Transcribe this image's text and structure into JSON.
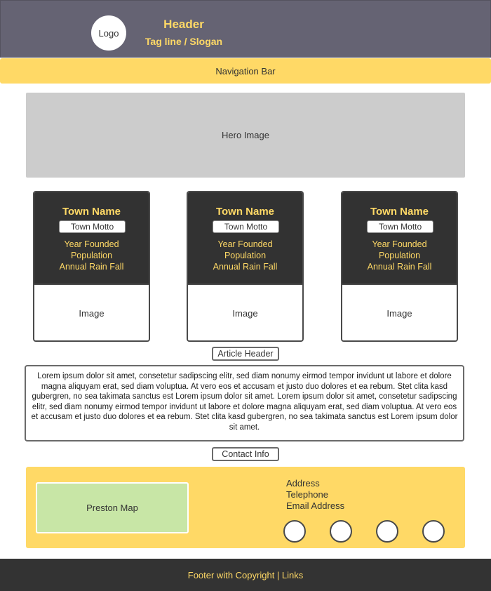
{
  "header": {
    "logo_label": "Logo",
    "title": "Header",
    "tagline": "Tag line / Slogan"
  },
  "navigation": {
    "label": "Navigation Bar"
  },
  "hero": {
    "label": "Hero Image"
  },
  "towns": [
    {
      "name": "Town Name",
      "motto": "Town Motto",
      "year": "Year Founded",
      "population": "Population",
      "rainfall": "Annual Rain Fall",
      "image_label": "Image"
    },
    {
      "name": "Town Name",
      "motto": "Town Motto",
      "year": "Year Founded",
      "population": "Population",
      "rainfall": "Annual Rain Fall",
      "image_label": "Image"
    },
    {
      "name": "Town Name",
      "motto": "Town Motto",
      "year": "Year Founded",
      "population": "Population",
      "rainfall": "Annual Rain Fall",
      "image_label": "Image"
    }
  ],
  "article": {
    "header": "Article Header",
    "body": "Lorem ipsum dolor sit amet, consetetur sadipscing elitr, sed diam nonumy eirmod tempor invidunt ut labore et dolore magna aliquyam erat, sed diam voluptua. At vero eos et accusam et justo duo dolores et ea rebum. Stet clita kasd gubergren, no sea takimata sanctus est Lorem ipsum dolor sit amet. Lorem ipsum dolor sit amet, consetetur sadipscing elitr, sed diam nonumy eirmod tempor invidunt ut labore et dolore magna aliquyam erat, sed diam voluptua. At vero eos et accusam et justo duo dolores et ea rebum. Stet clita kasd gubergren, no sea takimata sanctus est Lorem ipsum dolor sit amet."
  },
  "contact": {
    "header": "Contact Info",
    "map_label": "Preston Map",
    "address": "Address",
    "telephone": "Telephone",
    "email": "Email Address",
    "social_icons": [
      "social-circle-icon",
      "social-circle-icon",
      "social-circle-icon",
      "social-circle-icon"
    ]
  },
  "footer": {
    "text": "Footer with Copyright | Links"
  },
  "colors": {
    "header_bg": "#656373",
    "accent_yellow": "#ffd966",
    "card_dark": "#323232",
    "hero_gray": "#cccccc",
    "map_green": "#c8e6a6",
    "footer_bg": "#333333"
  }
}
